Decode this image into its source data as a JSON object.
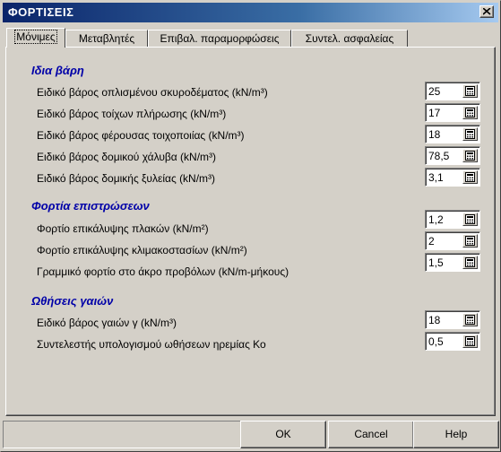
{
  "window": {
    "title": "ΦΟΡΤΙΣΕΙΣ"
  },
  "tabs": [
    {
      "label": "Μόνιμες",
      "active": true
    },
    {
      "label": "Μεταβλητές",
      "active": false
    },
    {
      "label": "Επιβαλ. παραμορφώσεις",
      "active": false
    },
    {
      "label": "Συντελ. ασφαλείας",
      "active": false
    }
  ],
  "sections": {
    "self_weights": {
      "title": "Ιδια βάρη",
      "rows": [
        {
          "label": "Ειδικό βάρος οπλισμένου σκυροδέματος (kN/m³)",
          "value": "25"
        },
        {
          "label": "Ειδικό βάρος  τοίχων πλήρωσης (kN/m³)",
          "value": "17"
        },
        {
          "label": "Ειδικό βάρος φέρουσας τοιχοποιίας (kN/m³)",
          "value": "18"
        },
        {
          "label": "Ειδικό βάρος δομικού χάλυβα (kN/m³)",
          "value": "78,5"
        },
        {
          "label": "Ειδικό βάρος δομικής ξυλείας  (kN/m³)",
          "value": "3,1"
        }
      ]
    },
    "finishes": {
      "title": "Φορτία  επιστρώσεων",
      "rows": [
        {
          "label": "Φορτίο επικάλυψης πλακών  (kN/m²)",
          "value": "1,2"
        },
        {
          "label": "Φορτίο επικάλυψης κλιμακοστασίων  (kN/m²)",
          "value": "2"
        },
        {
          "label": "Γραμμικό φορτίο στο άκρο προβόλων  (kN/m-μήκους)",
          "value": "1,5"
        }
      ]
    },
    "earth": {
      "title": "Ωθήσεις γαιών",
      "rows": [
        {
          "label": "Ειδικό βάρος γαιών γ  (kN/m³)",
          "value": "18"
        },
        {
          "label": "Συντελεστής υπολογισμού ωθήσεων ηρεμίας Κο",
          "value": "0,5"
        }
      ]
    }
  },
  "buttons": {
    "ok": "OK",
    "cancel": "Cancel",
    "help": "Help"
  },
  "icons": {
    "field_button": "calculator-icon",
    "close": "close-icon"
  }
}
